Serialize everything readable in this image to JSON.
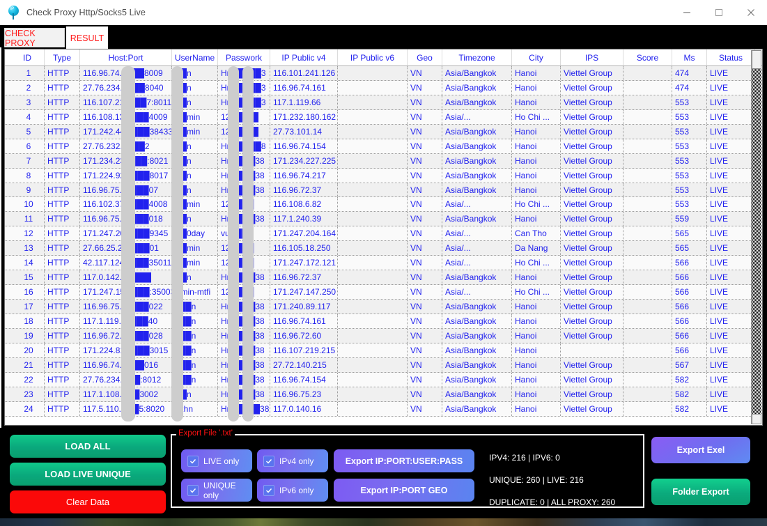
{
  "window": {
    "title": "Check Proxy Http/Socks5 Live",
    "icon": "ip-pin-icon",
    "minimize_label": "minimize-icon",
    "maximize_label": "maximize-icon",
    "close_label": "close-icon"
  },
  "tabs": [
    {
      "label": "CHECK PROXY",
      "active": false
    },
    {
      "label": "RESULT",
      "active": true
    }
  ],
  "table": {
    "columns": [
      "ID",
      "Type",
      "Host:Port",
      "UserName",
      "Passwork",
      "IP Public v4",
      "IP Public v6",
      "Geo",
      "Timezone",
      "City",
      "IPS",
      "Score",
      "Ms",
      "Status"
    ],
    "rows": [
      {
        "id": "1",
        "type": "HTTP",
        "host": "116.96.74.1███8009",
        "user": "██n",
        "pass": "Hn█████3",
        "ipv4": "116.101.241.126",
        "ipv6": "",
        "geo": "VN",
        "timezone": "Asia/Bangkok",
        "city": "Hanoi",
        "ips": "Viettel Group",
        "score": "",
        "ms": "474",
        "status": "LIVE"
      },
      {
        "id": "2",
        "type": "HTTP",
        "host": "27.76.234.1███8040",
        "user": "██n",
        "pass": "Hn█████3",
        "ipv4": "116.96.74.161",
        "ipv6": "",
        "geo": "VN",
        "timezone": "Asia/Bangkok",
        "city": "Hanoi",
        "ips": "Viettel Group",
        "score": "",
        "ms": "474",
        "status": "LIVE"
      },
      {
        "id": "3",
        "type": "HTTP",
        "host": "116.107.219███7:8011",
        "user": "██n",
        "pass": "Hn█████3",
        "ipv4": "117.1.119.66",
        "ipv6": "",
        "geo": "VN",
        "timezone": "Asia/Bangkok",
        "city": "Hanoi",
        "ips": "Viettel Group",
        "score": "",
        "ms": "553",
        "status": "LIVE"
      },
      {
        "id": "4",
        "type": "HTTP",
        "host": "116.108.13.1███4009",
        "user": "██min",
        "pass": "123████",
        "ipv4": "171.232.180.162",
        "ipv6": "",
        "geo": "VN",
        "timezone": "Asia/...",
        "city": "Ho Chi ...",
        "ips": "Viettel Group",
        "score": "",
        "ms": "553",
        "status": "LIVE"
      },
      {
        "id": "5",
        "type": "HTTP",
        "host": "171.242.44.1███38433",
        "user": "██min",
        "pass": "123████",
        "ipv4": "27.73.101.14",
        "ipv6": "",
        "geo": "VN",
        "timezone": "Asia/Bangkok",
        "city": "Hanoi",
        "ips": "Viettel Group",
        "score": "",
        "ms": "553",
        "status": "LIVE"
      },
      {
        "id": "6",
        "type": "HTTP",
        "host": "27.76.232.2███2",
        "user": "██n",
        "pass": "Hn█████8",
        "ipv4": "116.96.74.154",
        "ipv6": "",
        "geo": "VN",
        "timezone": "Asia/Bangkok",
        "city": "Hanoi",
        "ips": "Viettel Group",
        "score": "",
        "ms": "553",
        "status": "LIVE"
      },
      {
        "id": "7",
        "type": "HTTP",
        "host": "171.234.230███:8021",
        "user": "██n",
        "pass": "Hn████38",
        "ipv4": "171.234.227.225",
        "ipv6": "",
        "geo": "VN",
        "timezone": "Asia/Bangkok",
        "city": "Hanoi",
        "ips": "Viettel Group",
        "score": "",
        "ms": "553",
        "status": "LIVE"
      },
      {
        "id": "8",
        "type": "HTTP",
        "host": "171.224.92.1███8017",
        "user": "██n",
        "pass": "Hn████38",
        "ipv4": "116.96.74.217",
        "ipv6": "",
        "geo": "VN",
        "timezone": "Asia/Bangkok",
        "city": "Hanoi",
        "ips": "Viettel Group",
        "score": "",
        "ms": "553",
        "status": "LIVE"
      },
      {
        "id": "9",
        "type": "HTTP",
        "host": "116.96.75.55███07",
        "user": "██n",
        "pass": "Hn████38",
        "ipv4": "116.96.72.37",
        "ipv6": "",
        "geo": "VN",
        "timezone": "Asia/Bangkok",
        "city": "Hanoi",
        "ips": "Viettel Group",
        "score": "",
        "ms": "553",
        "status": "LIVE"
      },
      {
        "id": "10",
        "type": "HTTP",
        "host": "116.102.37.1███4008",
        "user": "██min",
        "pass": "12████",
        "ipv4": "116.108.6.82",
        "ipv6": "",
        "geo": "VN",
        "timezone": "Asia/...",
        "city": "Ho Chi ...",
        "ips": "Viettel Group",
        "score": "",
        "ms": "553",
        "status": "LIVE"
      },
      {
        "id": "11",
        "type": "HTTP",
        "host": "116.96.75.22███018",
        "user": "██n",
        "pass": "Hn████38",
        "ipv4": "117.1.240.39",
        "ipv6": "",
        "geo": "VN",
        "timezone": "Asia/Bangkok",
        "city": "Hanoi",
        "ips": "Viettel Group",
        "score": "",
        "ms": "559",
        "status": "LIVE"
      },
      {
        "id": "12",
        "type": "HTTP",
        "host": "171.247.204.███9345",
        "user": "██0day",
        "pass": "vu████",
        "ipv4": "171.247.204.164",
        "ipv6": "",
        "geo": "VN",
        "timezone": "Asia/...",
        "city": "Can Tho",
        "ips": "Viettel Group",
        "score": "",
        "ms": "565",
        "status": "LIVE"
      },
      {
        "id": "13",
        "type": "HTTP",
        "host": "27.66.25.247███01",
        "user": "██min",
        "pass": "12████",
        "ipv4": "116.105.18.250",
        "ipv6": "",
        "geo": "VN",
        "timezone": "Asia/...",
        "city": "Da Nang",
        "ips": "Viettel Group",
        "score": "",
        "ms": "565",
        "status": "LIVE"
      },
      {
        "id": "14",
        "type": "HTTP",
        "host": "42.117.124.1███35011",
        "user": "██min",
        "pass": "12████",
        "ipv4": "171.247.172.121",
        "ipv6": "",
        "geo": "VN",
        "timezone": "Asia/...",
        "city": "Ho Chi ...",
        "ips": "Viettel Group",
        "score": "",
        "ms": "566",
        "status": "LIVE"
      },
      {
        "id": "15",
        "type": "HTTP",
        "host": "117.0.142.6:8███",
        "user": "██n",
        "pass": "Hn████38",
        "ipv4": "116.96.72.37",
        "ipv6": "",
        "geo": "VN",
        "timezone": "Asia/Bangkok",
        "city": "Hanoi",
        "ips": "Viettel Group",
        "score": "",
        "ms": "566",
        "status": "LIVE"
      },
      {
        "id": "16",
        "type": "HTTP",
        "host": "171.247.152.███:35003",
        "user": "█min-mtfi",
        "pass": "12████",
        "ipv4": "171.247.147.250",
        "ipv6": "",
        "geo": "VN",
        "timezone": "Asia/...",
        "city": "Ho Chi ...",
        "ips": "Viettel Group",
        "score": "",
        "ms": "566",
        "status": "LIVE"
      },
      {
        "id": "17",
        "type": "HTTP",
        "host": "116.96.75.22███022",
        "user": "p██n",
        "pass": "Hn████38",
        "ipv4": "171.240.89.117",
        "ipv6": "",
        "geo": "VN",
        "timezone": "Asia/Bangkok",
        "city": "Hanoi",
        "ips": "Viettel Group",
        "score": "",
        "ms": "566",
        "status": "LIVE"
      },
      {
        "id": "18",
        "type": "HTTP",
        "host": "117.1.119.66███40",
        "user": "p██n",
        "pass": "Hn████38",
        "ipv4": "116.96.74.161",
        "ipv6": "",
        "geo": "VN",
        "timezone": "Asia/Bangkok",
        "city": "Hanoi",
        "ips": "Viettel Group",
        "score": "",
        "ms": "566",
        "status": "LIVE"
      },
      {
        "id": "19",
        "type": "HTTP",
        "host": "116.96.72.15███028",
        "user": "p██n",
        "pass": "Hn████38",
        "ipv4": "116.96.72.60",
        "ipv6": "",
        "geo": "VN",
        "timezone": "Asia/Bangkok",
        "city": "Hanoi",
        "ips": "Viettel Group",
        "score": "",
        "ms": "566",
        "status": "LIVE"
      },
      {
        "id": "20",
        "type": "HTTP",
        "host": "171.224.81.1███3015",
        "user": "p██n",
        "pass": "Hn████38",
        "ipv4": "116.107.219.215",
        "ipv6": "",
        "geo": "VN",
        "timezone": "Asia/Bangkok",
        "city": "Hanoi",
        "ips": "",
        "score": "",
        "ms": "566",
        "status": "LIVE"
      },
      {
        "id": "21",
        "type": "HTTP",
        "host": "116.96.74.1███016",
        "user": "p██n",
        "pass": "Hn████38",
        "ipv4": "27.72.140.215",
        "ipv6": "",
        "geo": "VN",
        "timezone": "Asia/Bangkok",
        "city": "Hanoi",
        "ips": "Viettel Group",
        "score": "",
        "ms": "567",
        "status": "LIVE"
      },
      {
        "id": "22",
        "type": "HTTP",
        "host": "27.76.234.███:8012",
        "user": "p██n",
        "pass": "Hn████38",
        "ipv4": "116.96.74.154",
        "ipv6": "",
        "geo": "VN",
        "timezone": "Asia/Bangkok",
        "city": "Hanoi",
        "ips": "Viettel Group",
        "score": "",
        "ms": "582",
        "status": "LIVE"
      },
      {
        "id": "23",
        "type": "HTTP",
        "host": "117.1.108.███3002",
        "user": "██n",
        "pass": "Hn████38",
        "ipv4": "116.96.75.23",
        "ipv6": "",
        "geo": "VN",
        "timezone": "Asia/Bangkok",
        "city": "Hanoi",
        "ips": "Viettel Group",
        "score": "",
        "ms": "582",
        "status": "LIVE"
      },
      {
        "id": "24",
        "type": "HTTP",
        "host": "117.5.110.███5:8020",
        "user": "pxhn",
        "pass": "Hne████38",
        "ipv4": "117.0.140.16",
        "ipv6": "",
        "geo": "VN",
        "timezone": "Asia/Bangkok",
        "city": "Hanoi",
        "ips": "Viettel Group",
        "score": "",
        "ms": "582",
        "status": "LIVE"
      }
    ]
  },
  "actions": {
    "load_all": "LOAD ALL",
    "load_live_unique": "LOAD LIVE UNIQUE",
    "clear_data": "Clear Data",
    "export_exel": "Export Exel",
    "folder_export": "Folder Export"
  },
  "export_panel": {
    "title": "Export File '.txt'",
    "checkboxes": [
      {
        "label": "LIVE only",
        "checked": true
      },
      {
        "label": "IPv4 only",
        "checked": true
      },
      {
        "label": "UNIQUE only",
        "checked": true
      },
      {
        "label": "IPv6 only",
        "checked": true
      }
    ],
    "buttons": [
      {
        "label": "Export IP:PORT:USER:PASS"
      },
      {
        "label": "Export IP:PORT GEO"
      }
    ],
    "stats": [
      "IPV4: 216 | IPV6: 0",
      "UNIQUE: 260 | LIVE: 216",
      "DUPLICATE: 0 | ALL PROXY: 260"
    ]
  },
  "colors": {
    "grid_text": "#2222ee",
    "tab_text": "#ff1a1a",
    "green": "#0aa87c",
    "red": "#fb0909",
    "purple": "#6f5bf0"
  }
}
